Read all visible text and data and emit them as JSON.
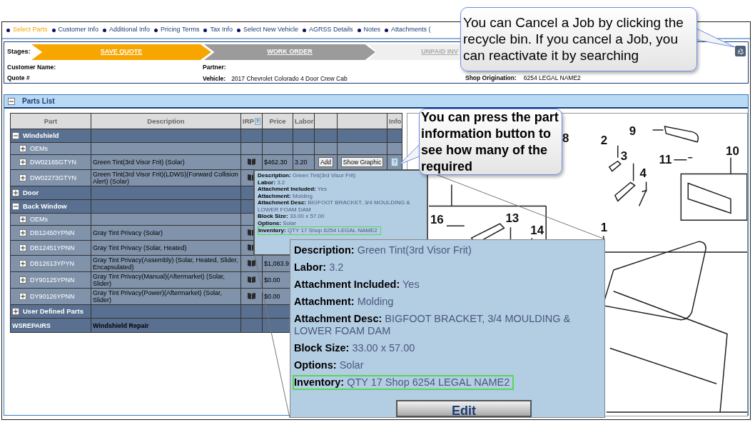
{
  "nav": {
    "tabs": [
      {
        "label": "Select Parts",
        "selected": true
      },
      {
        "label": "Customer Info",
        "selected": false
      },
      {
        "label": "Additional Info",
        "selected": false
      },
      {
        "label": "Pricing Terms",
        "selected": false
      },
      {
        "label": "Tax Info",
        "selected": false
      },
      {
        "label": "Select New Vehicle",
        "selected": false
      },
      {
        "label": "AGRSS Details",
        "selected": false
      },
      {
        "label": "Notes",
        "selected": false
      },
      {
        "label": "Attachments (",
        "selected": false
      }
    ]
  },
  "stages": {
    "label": "Stages:",
    "items": [
      {
        "label": "SAVE QUOTE",
        "selected": true
      },
      {
        "label": "WORK ORDER",
        "selected": false,
        "available": true
      },
      {
        "label": "UNPAID INV",
        "selected": false,
        "available": false
      }
    ]
  },
  "job_info": {
    "customer_name_label": "Customer Name:",
    "quote_label": "Quote #",
    "partner_label": "Partner:",
    "vehicle_label": "Vehicle:",
    "vehicle": "2017 Chevrolet Colorado 4 Door Crew Cab",
    "shop_label": "Shop Origination:",
    "shop": "6254 LEGAL NAME2"
  },
  "parts_list": {
    "title": "Parts List",
    "expanded": true,
    "columns": [
      {
        "label": "Part"
      },
      {
        "label": "Description"
      },
      {
        "label": "IRP",
        "help": "?"
      },
      {
        "label": "Price"
      },
      {
        "label": "Labor"
      },
      {
        "label": "Info"
      }
    ],
    "rows": [
      {
        "kind": "group",
        "label": "Windshield",
        "expanded": true
      },
      {
        "kind": "subgroup",
        "label": "OEMs",
        "expanded": false
      },
      {
        "kind": "part",
        "part": "DW02165GTYN",
        "description": "Green Tint(3rd Visor Frit) (Solar)",
        "irp": true,
        "price": "$462.30",
        "labor": "3.20",
        "add": "Add",
        "graphic": "Show Graphic",
        "info": "?",
        "expanded": false
      },
      {
        "kind": "part",
        "part": "DW02273GTYN",
        "description": "Green Tint(3rd Visor Frit)(LDWS)(Forward Collision Alert) (Solar)",
        "irp": true,
        "expanded": false
      },
      {
        "kind": "group",
        "label": "Door",
        "expanded": false
      },
      {
        "kind": "group",
        "label": "Back Window",
        "expanded": true
      },
      {
        "kind": "subgroup",
        "label": "OEMs",
        "expanded": false
      },
      {
        "kind": "part",
        "part": "DB12450YPNN",
        "description": "Gray Tint Privacy (Solar)",
        "irp": true,
        "expanded": false
      },
      {
        "kind": "part",
        "part": "DB12451YPNN",
        "description": "Gray Tint Privacy (Solar, Heated)",
        "irp": true,
        "expanded": false
      },
      {
        "kind": "part",
        "part": "DB12613YPYN",
        "description": "Gray Tint Privacy(Assembly) (Solar, Heated, Slider, Encapsulated)",
        "irp": true,
        "price": "$1,083.9",
        "expanded": false
      },
      {
        "kind": "part",
        "part": "DY90125YPNN",
        "description": "Gray Tint Privacy(Manual)(Aftermarket) (Solar, Slider)",
        "irp": true,
        "price": "$0.00",
        "expanded": false
      },
      {
        "kind": "part",
        "part": "DY90126YPNN",
        "description": "Gray Tint Privacy(Power)(Aftermarket) (Solar, Slider)",
        "irp": true,
        "price": "$0.00",
        "expanded": false
      },
      {
        "kind": "group",
        "label": "User Defined Parts",
        "expanded": false
      },
      {
        "kind": "service",
        "part": "WSREPAIRS",
        "description": "Windshield Repair"
      }
    ]
  },
  "info_popup": {
    "lines": [
      {
        "label": "Description:",
        "value": "Green Tint(3rd Visor Frit)",
        "highlighted": false
      },
      {
        "label": "Labor:",
        "value": "3.2",
        "highlighted": false
      },
      {
        "label": "Attachment Included:",
        "value": "Yes",
        "highlighted": false
      },
      {
        "label": "Attachment:",
        "value": "Molding",
        "highlighted": false
      },
      {
        "label": "Attachment Desc:",
        "value": "BIGFOOT BRACKET, 3/4 MOULDING & LOWER FOAM DAM",
        "highlighted": false
      },
      {
        "label": "Block Size:",
        "value": "33.00 x 57.00",
        "highlighted": false
      },
      {
        "label": "Options:",
        "value": "Solar",
        "highlighted": false
      },
      {
        "label": "Inventory:",
        "value": "QTY 17 Shop 6254 LEGAL NAME2",
        "highlighted": true
      }
    ]
  },
  "info_popup_zoom": {
    "lines": [
      {
        "label": "Description:",
        "value": "Green Tint(3rd Visor Frit)",
        "highlighted": false
      },
      {
        "label": "Labor:",
        "value": "3.2",
        "highlighted": false
      },
      {
        "label": "Attachment Included:",
        "value": "Yes",
        "highlighted": false
      },
      {
        "label": "Attachment:",
        "value": "Molding",
        "highlighted": false
      },
      {
        "label": "Attachment Desc:",
        "value": "BIGFOOT BRACKET, 3/4 MOULDING & LOWER FOAM DAM",
        "highlighted": false
      },
      {
        "label": "Block Size:",
        "value": "33.00 x 57.00",
        "highlighted": false
      },
      {
        "label": "Options:",
        "value": "Solar",
        "highlighted": false
      },
      {
        "label": "Inventory:",
        "value": "QTY 17 Shop 6254 LEGAL NAME2",
        "highlighted": true
      }
    ],
    "button": "Edit"
  },
  "diagram": {
    "labels": [
      "8",
      "2",
      "9",
      "3",
      "11",
      "10",
      "4",
      "16",
      "13",
      "14",
      "1"
    ]
  },
  "callouts": [
    {
      "text": "You can press the part information button to see how many of the required"
    },
    {
      "text": "You can Cancel a Job by clicking the recycle bin. If you cancel a Job, you can reactivate it by searching"
    }
  ]
}
